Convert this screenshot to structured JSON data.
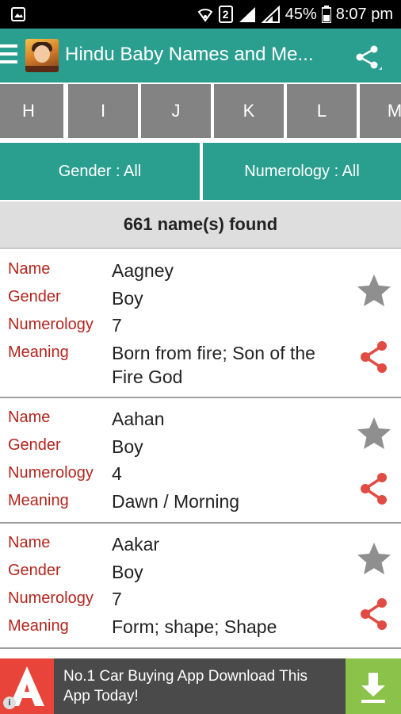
{
  "status_bar": {
    "battery": "45%",
    "time": "8:07 pm",
    "sim_slot": "2"
  },
  "app_bar": {
    "title": "Hindu Baby Names and Me..."
  },
  "letters": [
    "H",
    "I",
    "J",
    "K",
    "L",
    "M"
  ],
  "filters": {
    "gender": "Gender : All",
    "numerology": "Numerology : All"
  },
  "results": {
    "count_text": "661 name(s) found"
  },
  "field_labels": {
    "name": "Name",
    "gender": "Gender",
    "numerology": "Numerology",
    "meaning": "Meaning"
  },
  "names": [
    {
      "name": "Aagney",
      "gender": "Boy",
      "numerology": "7",
      "meaning": "Born from fire; Son of the Fire God"
    },
    {
      "name": "Aahan",
      "gender": "Boy",
      "numerology": "4",
      "meaning": "Dawn / Morning"
    },
    {
      "name": "Aakar",
      "gender": "Boy",
      "numerology": "7",
      "meaning": "Form; shape; Shape"
    }
  ],
  "ad": {
    "text": "No.1 Car Buying App Download This App Today!"
  },
  "colors": {
    "primary": "#2b9f8f",
    "tab_gray": "#838383",
    "label_red": "#b3261e",
    "share_red": "#e24b43",
    "star_gray": "#8f8f8f",
    "ad_green": "#8bc34a"
  }
}
